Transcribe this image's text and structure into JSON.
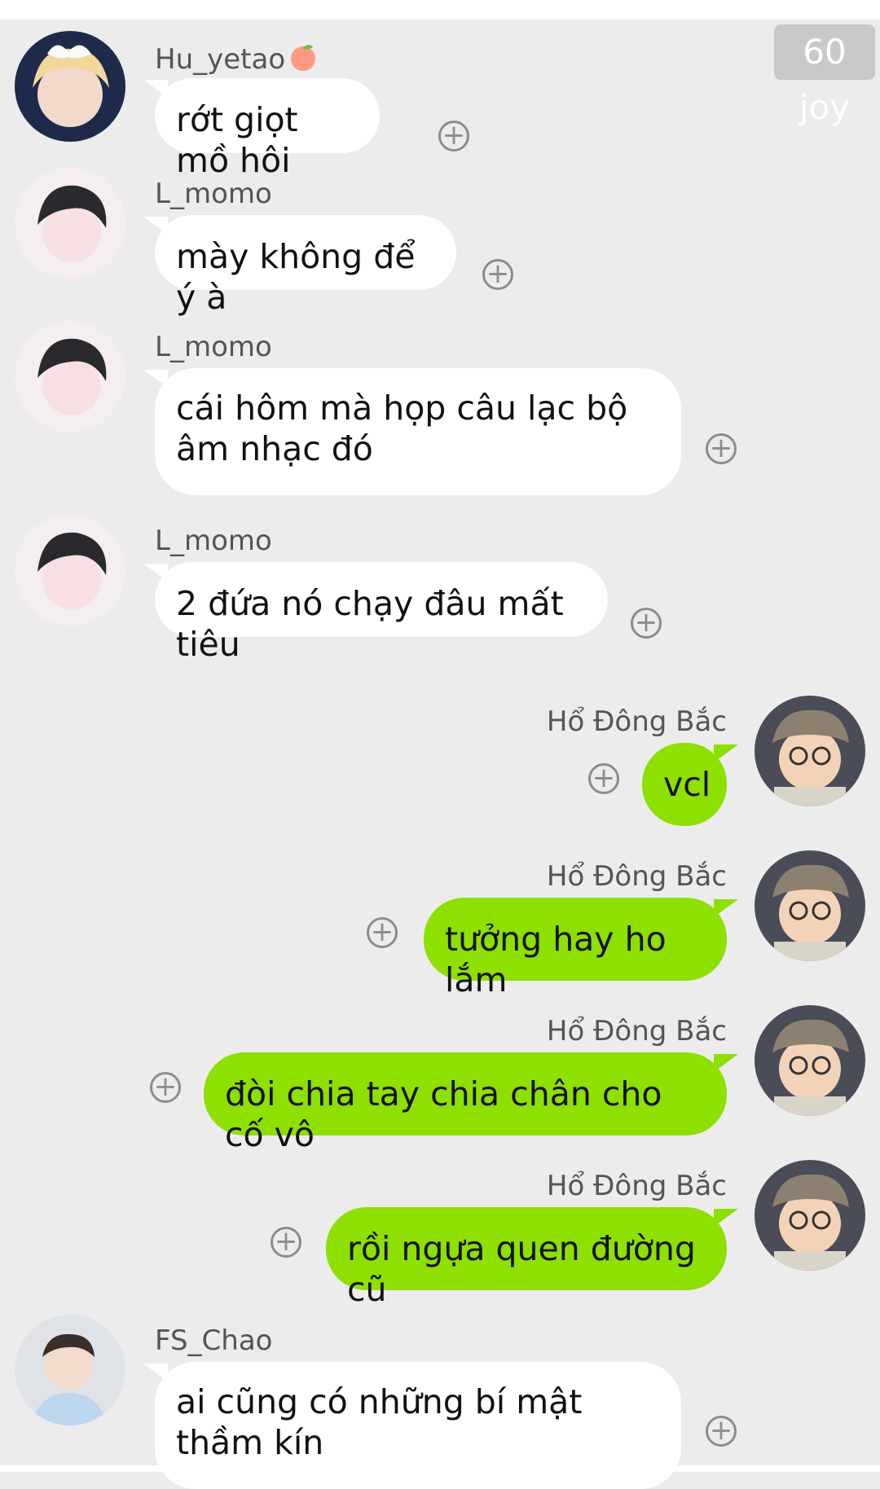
{
  "badge": "60 joy",
  "messages": [
    {
      "sender": "Hu_yetao",
      "text": "rớt giọt mồ hôi"
    },
    {
      "sender": "L_momo",
      "text": "mày không để ý à"
    },
    {
      "sender": "L_momo",
      "text": "cái hôm mà họp câu lạc bộ âm nhạc đó"
    },
    {
      "sender": "L_momo",
      "text": "2 đứa nó chạy đâu mất tiêu"
    },
    {
      "sender": "Hổ Đông Bắc",
      "text": "vcl"
    },
    {
      "sender": "Hổ Đông Bắc",
      "text": "tưởng hay ho lắm"
    },
    {
      "sender": "Hổ Đông Bắc",
      "text": "đòi chia tay chia chân cho cố vô"
    },
    {
      "sender": "Hổ Đông Bắc",
      "text": "rồi ngựa quen đường cũ"
    },
    {
      "sender": "FS_Chao",
      "text": "ai cũng có những bí mật thầm kín"
    }
  ],
  "colors": {
    "outgoing_bubble": "#8ee000",
    "incoming_bubble": "#ffffff",
    "background": "#ececec"
  },
  "icons": {
    "add_reaction": "plus-circle-icon",
    "sender_badge": "peach-emoji-icon"
  }
}
